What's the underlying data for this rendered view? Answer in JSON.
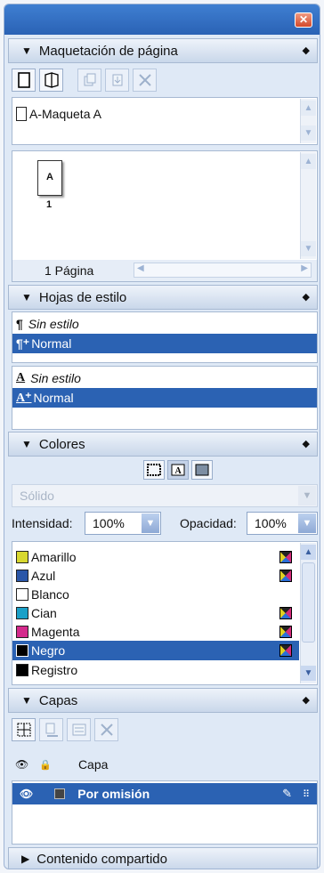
{
  "window": {
    "close_label": "✕"
  },
  "page_layout": {
    "title": "Maquetación de página",
    "master_item": "A-Maqueta A",
    "page_thumb_letter": "A",
    "page_number": "1",
    "page_count": "1 Página"
  },
  "styles": {
    "title": "Hojas de estilo",
    "paragraph_styles": [
      "Sin estilo",
      "Normal"
    ],
    "character_styles": [
      "Sin estilo",
      "Normal"
    ]
  },
  "colors": {
    "title": "Colores",
    "fill_type": "Sólido",
    "intensity_label": "Intensidad:",
    "intensity_value": "100%",
    "opacity_label": "Opacidad:",
    "opacity_value": "100%",
    "swatches": [
      {
        "name": "Amarillo",
        "color": "#d8d830",
        "cmyk": true
      },
      {
        "name": "Azul",
        "color": "#2a56a8",
        "cmyk": true
      },
      {
        "name": "Blanco",
        "color": "#ffffff",
        "cmyk": false
      },
      {
        "name": "Cian",
        "color": "#1aa0c8",
        "cmyk": true
      },
      {
        "name": "Magenta",
        "color": "#d42a8c",
        "cmyk": true
      },
      {
        "name": "Negro",
        "color": "#000000",
        "cmyk": true
      },
      {
        "name": "Registro",
        "color": "#000000",
        "cmyk": false
      }
    ],
    "selected": "Negro"
  },
  "layers": {
    "title": "Capas",
    "column_label": "Capa",
    "items": [
      {
        "name": "Por omisión"
      }
    ]
  },
  "shared_content": {
    "title": "Contenido compartido"
  },
  "accent": "#2b62b3"
}
